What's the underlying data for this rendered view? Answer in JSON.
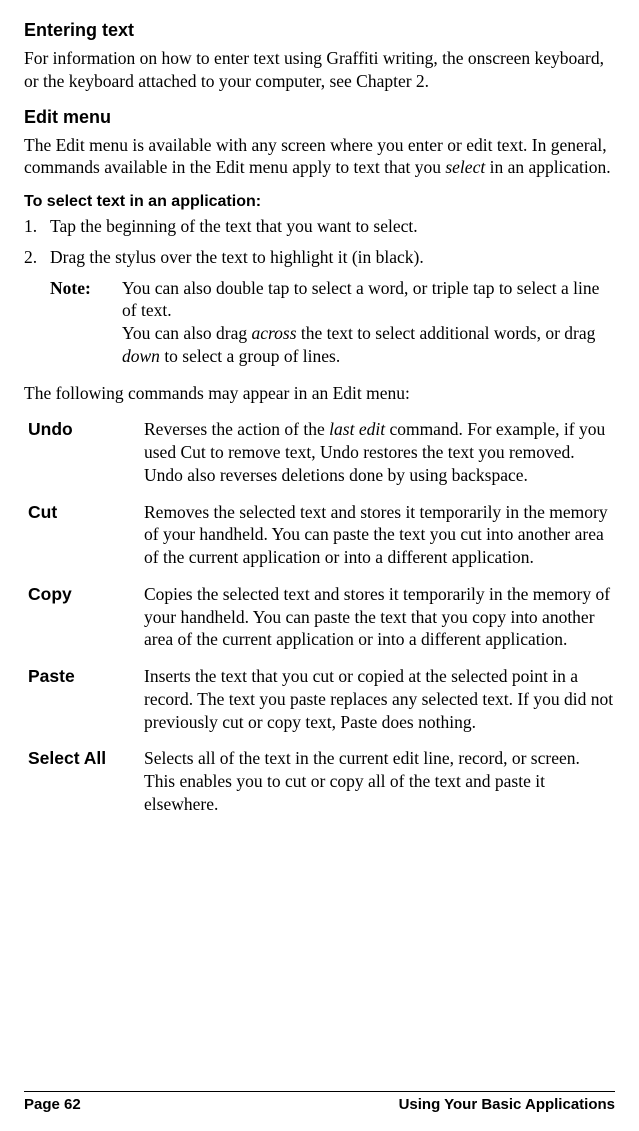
{
  "section1": {
    "title": "Entering text",
    "body": "For information on how to enter text using Graffiti writing, the onscreen keyboard, or the keyboard attached to your computer, see Chapter 2."
  },
  "section2": {
    "title": "Edit menu",
    "body_pre": "The Edit menu is available with any screen where you enter or edit text. In general, commands available in the Edit menu apply to text that you ",
    "body_italic": "select",
    "body_post": " in an application."
  },
  "subheading": "To select text in an application:",
  "steps": [
    {
      "num": "1.",
      "text": "Tap the beginning of the text that you want to select."
    },
    {
      "num": "2.",
      "text": "Drag the stylus over the text to highlight it (in black)."
    }
  ],
  "note": {
    "label": "Note:",
    "line1_pre": "You can also double tap to select a word, or triple tap to select a line of text.",
    "line2_pre": "You can also drag ",
    "line2_italic1": "across",
    "line2_mid": " the text to select additional words, or drag ",
    "line2_italic2": "down",
    "line2_post": " to select a group of lines."
  },
  "followup": "The following commands may appear in an Edit menu:",
  "edit_commands": [
    {
      "term": "Undo",
      "desc_pre": "Reverses the action of the ",
      "desc_italic": "last edit",
      "desc_post": " command. For example, if you used Cut to remove text, Undo restores the text you removed. Undo also reverses deletions done by using backspace."
    },
    {
      "term": "Cut",
      "desc_pre": "Removes the selected text and stores it temporarily in the memory of your handheld. You can paste the text you cut into another area of the current application or into a different application.",
      "desc_italic": "",
      "desc_post": ""
    },
    {
      "term": "Copy",
      "desc_pre": "Copies the selected text and stores it temporarily in the memory of your handheld. You can paste the text that you copy into another area of the current application or into a different application.",
      "desc_italic": "",
      "desc_post": ""
    },
    {
      "term": "Paste",
      "desc_pre": "Inserts the text that you cut or copied at the selected point in a record. The text you paste replaces any selected text. If you did not previously cut or copy text, Paste does nothing.",
      "desc_italic": "",
      "desc_post": ""
    },
    {
      "term": "Select All",
      "desc_pre": "Selects all of the text in the current edit line, record, or screen. This enables you to cut or copy all of the text and paste it elsewhere.",
      "desc_italic": "",
      "desc_post": ""
    }
  ],
  "footer": {
    "left": "Page 62",
    "right": "Using Your Basic Applications"
  }
}
